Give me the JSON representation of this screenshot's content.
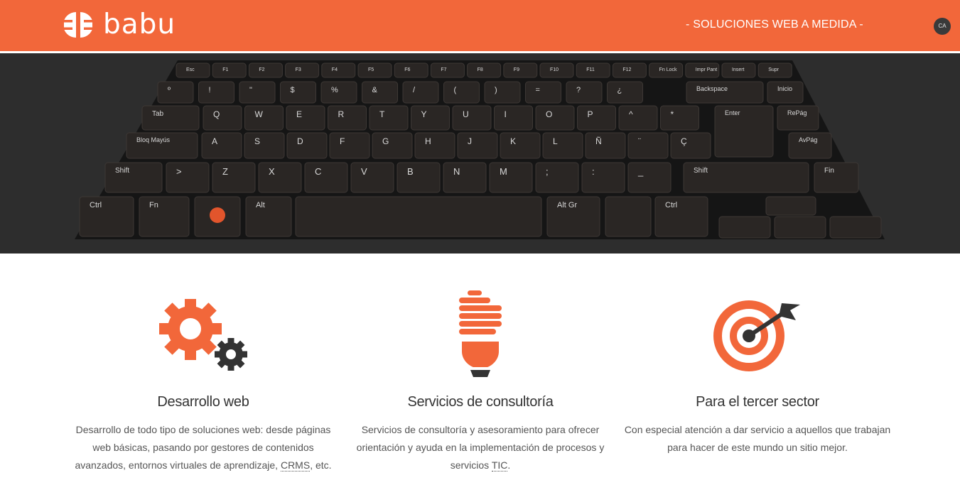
{
  "header": {
    "brand_name": "babu",
    "tagline": "- SOLUCIONES WEB A MEDIDA -",
    "lang_button": "CA",
    "bg_color": "#f2673a"
  },
  "hero": {
    "keyboard": {
      "row0": [
        "Esc",
        "F1",
        "F2",
        "F3",
        "F4",
        "F5",
        "F6",
        "F7",
        "F8",
        "F9",
        "F10",
        "F11",
        "F12",
        "Fn Lock",
        "Impr Pant",
        "Insert",
        "Supr"
      ],
      "row1": [
        "º",
        "!",
        "\"",
        "$",
        "%",
        "&",
        "/",
        "(",
        ")",
        "=",
        "?",
        "¿",
        "Backspace",
        "Inicio"
      ],
      "row2": [
        "Tab",
        "Q",
        "W",
        "E",
        "R",
        "T",
        "Y",
        "U",
        "I",
        "O",
        "P",
        "^",
        "*",
        "Enter",
        "RePág"
      ],
      "row3": [
        "Bloq Mayús",
        "A",
        "S",
        "D",
        "F",
        "G",
        "H",
        "J",
        "K",
        "L",
        "Ñ",
        "¨",
        "Ç",
        "AvPág"
      ],
      "row4": [
        "Shift",
        ">",
        "Z",
        "X",
        "C",
        "V",
        "B",
        "N",
        "M",
        ";",
        ":",
        "_",
        "Shift",
        "Fin"
      ],
      "row5": [
        "Ctrl",
        "Fn",
        "Alt",
        "Alt Gr",
        "Ctrl"
      ],
      "highlighted_keys": [
        "U",
        "A",
        "B"
      ],
      "highlight_color": "#e2552c"
    }
  },
  "features": [
    {
      "icon": "gears-icon",
      "title": "Desarrollo web",
      "text_before": "Desarrollo de todo tipo de soluciones web: desde páginas web básicas, pasando por gestores de contenidos avanzados, entornos virtuales de aprendizaje, ",
      "abbr": "CRMS",
      "text_after": ", etc."
    },
    {
      "icon": "lightbulb-icon",
      "title": "Servicios de consultoría",
      "text_before": "Servicios de consultoría y asesoramiento para ofrecer orientación y ayuda en la implementación de procesos y servicios ",
      "abbr": "TIC",
      "text_after": "."
    },
    {
      "icon": "target-icon",
      "title": "Para el tercer sector",
      "text_before": "Con especial atención a dar servicio a aquellos que trabajan para hacer de este mundo un sitio mejor.",
      "abbr": "",
      "text_after": ""
    }
  ],
  "colors": {
    "accent": "#f2673a",
    "dark": "#333333"
  }
}
